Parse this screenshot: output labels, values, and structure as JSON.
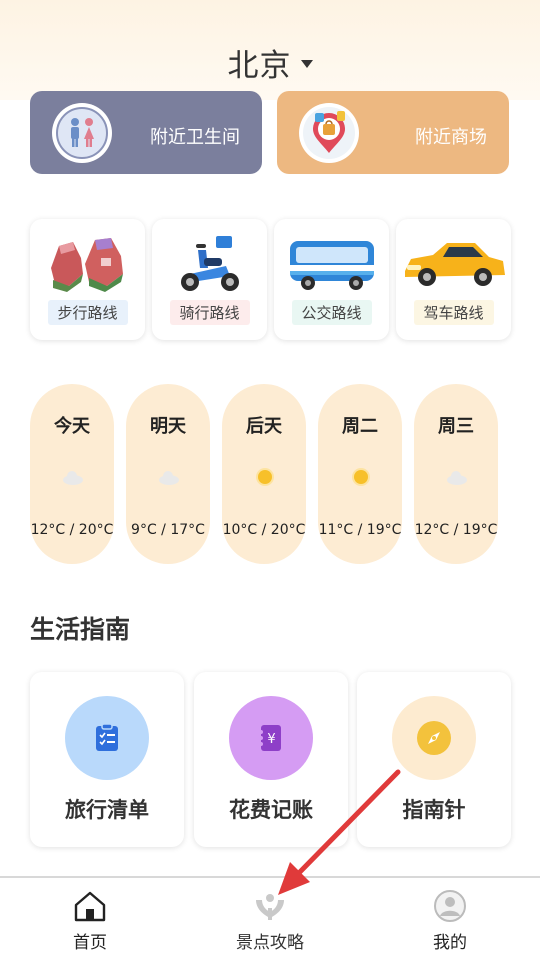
{
  "header": {
    "city": "北京"
  },
  "quick_cards": [
    {
      "label": "附近卫生间",
      "icon": "restroom-icon"
    },
    {
      "label": "附近商场",
      "icon": "mall-pin-icon"
    }
  ],
  "routes": [
    {
      "label": "步行路线",
      "icon": "sneakers-icon"
    },
    {
      "label": "骑行路线",
      "icon": "scooter-icon"
    },
    {
      "label": "公交路线",
      "icon": "bus-icon"
    },
    {
      "label": "驾车路线",
      "icon": "car-icon"
    }
  ],
  "weather": [
    {
      "day": "今天",
      "temp": "12°C / 20°C",
      "icon": "cloud-icon"
    },
    {
      "day": "明天",
      "temp": "9°C / 17°C",
      "icon": "cloud-icon"
    },
    {
      "day": "后天",
      "temp": "10°C / 20°C",
      "icon": "sun-icon"
    },
    {
      "day": "周二",
      "temp": "11°C / 19°C",
      "icon": "sun-icon"
    },
    {
      "day": "周三",
      "temp": "12°C / 19°C",
      "icon": "cloud-icon"
    }
  ],
  "life_guide": {
    "title": "生活指南",
    "items": [
      {
        "label": "旅行清单",
        "icon": "checklist-icon"
      },
      {
        "label": "花费记账",
        "icon": "ledger-icon"
      },
      {
        "label": "指南针",
        "icon": "compass-icon"
      }
    ]
  },
  "tabbar": {
    "items": [
      {
        "label": "首页",
        "icon": "home-icon"
      },
      {
        "label": "景点攻略",
        "icon": "attractions-icon"
      },
      {
        "label": "我的",
        "icon": "profile-icon"
      }
    ]
  },
  "colors": {
    "toilet_card": "#7b7f9d",
    "mall_card": "#edb881",
    "weather_card": "#fdecd3",
    "annotation_arrow": "#e03a3a"
  }
}
